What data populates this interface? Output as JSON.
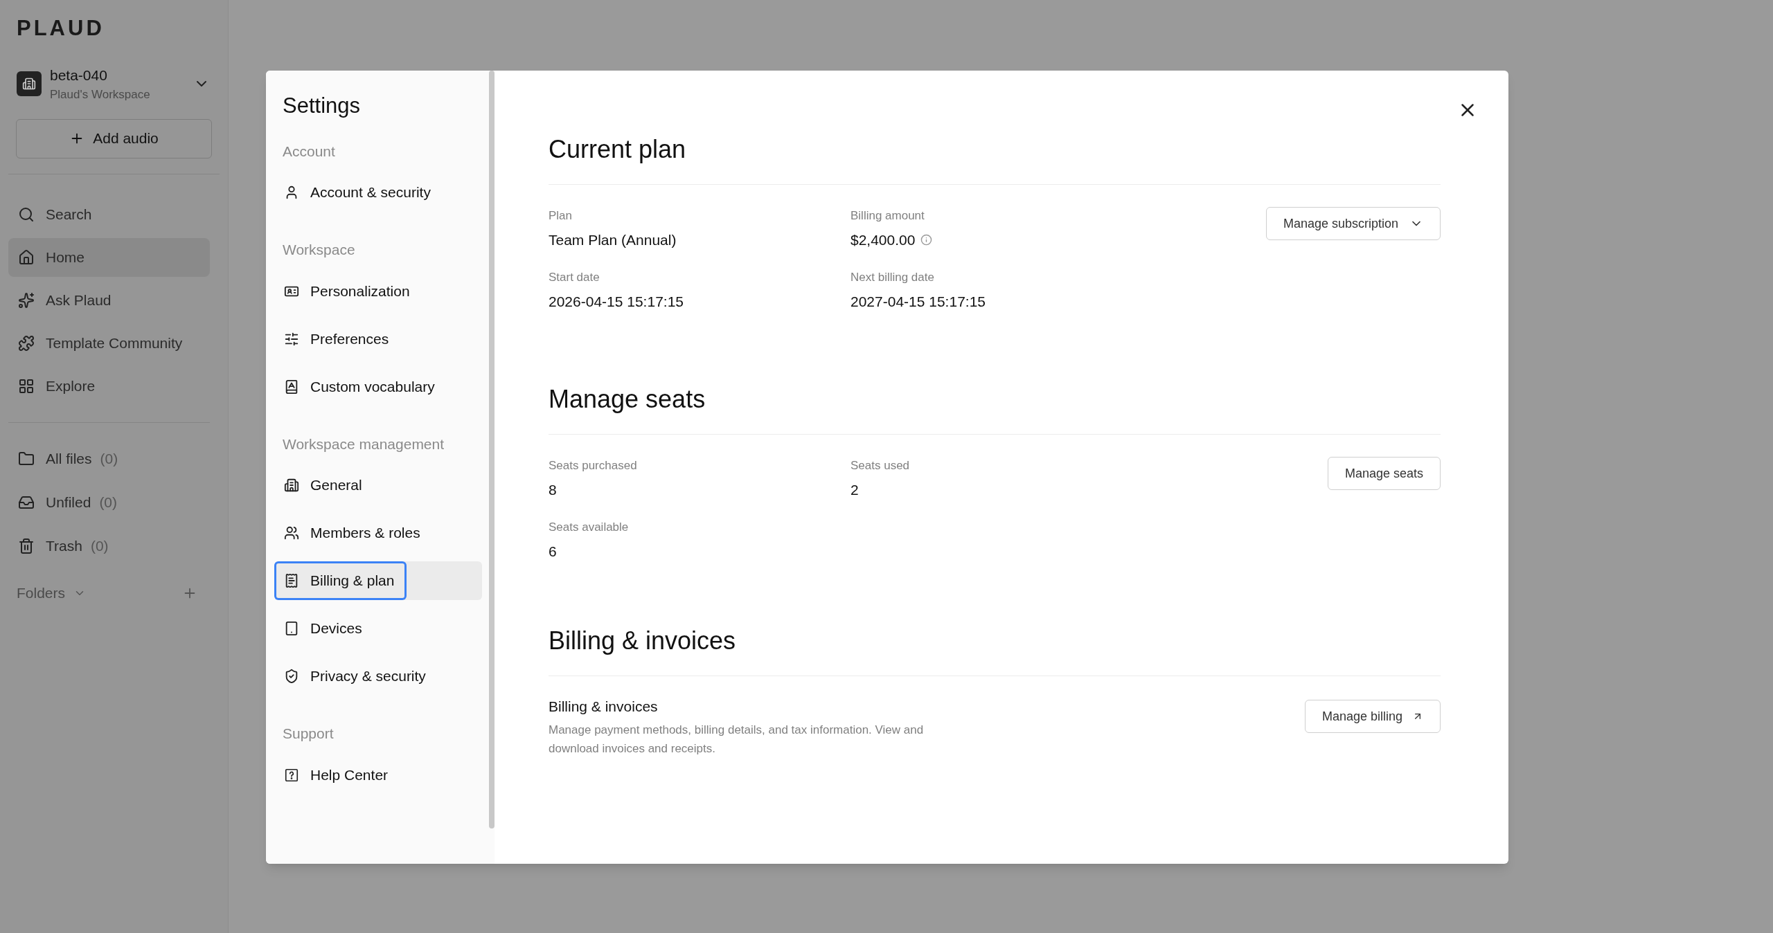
{
  "sidebar": {
    "logo": "PLAUD",
    "workspace": {
      "name": "beta-040",
      "subtitle": "Plaud's Workspace"
    },
    "add_button": "Add audio",
    "nav": [
      {
        "label": "Search",
        "selected": false
      },
      {
        "label": "Home",
        "selected": true
      },
      {
        "label": "Ask Plaud",
        "selected": false
      },
      {
        "label": "Template Community",
        "selected": false
      },
      {
        "label": "Explore",
        "selected": false
      }
    ],
    "files": [
      {
        "label": "All files",
        "count": "(0)"
      },
      {
        "label": "Unfiled",
        "count": "(0)"
      },
      {
        "label": "Trash",
        "count": "(0)"
      }
    ],
    "folders": "Folders"
  },
  "settings": {
    "title": "Settings",
    "sections": [
      {
        "heading": "Account",
        "items": [
          {
            "label": "Account & security",
            "selected": false,
            "focused": false
          }
        ]
      },
      {
        "heading": "Workspace",
        "items": [
          {
            "label": "Personalization",
            "selected": false,
            "focused": false
          },
          {
            "label": "Preferences",
            "selected": false,
            "focused": false
          },
          {
            "label": "Custom vocabulary",
            "selected": false,
            "focused": false
          }
        ]
      },
      {
        "heading": "Workspace management",
        "items": [
          {
            "label": "General",
            "selected": false,
            "focused": false
          },
          {
            "label": "Members & roles",
            "selected": false,
            "focused": false
          },
          {
            "label": "Billing & plan",
            "selected": true,
            "focused": true
          },
          {
            "label": "Devices",
            "selected": false,
            "focused": false
          },
          {
            "label": "Privacy & security",
            "selected": false,
            "focused": false
          }
        ]
      },
      {
        "heading": "Support",
        "items": [
          {
            "label": "Help Center",
            "selected": false,
            "focused": false
          }
        ]
      }
    ],
    "current_plan": {
      "heading": "Current plan",
      "fields": [
        {
          "label": "Plan",
          "value": "Team Plan (Annual)",
          "info": false
        },
        {
          "label": "Billing amount",
          "value": "$2,400.00",
          "info": true
        },
        {
          "label": "Start date",
          "value": "2026-04-15 15:17:15",
          "info": false
        },
        {
          "label": "Next billing date",
          "value": "2027-04-15 15:17:15",
          "info": false
        }
      ],
      "button": "Manage subscription"
    },
    "seats": {
      "heading": "Manage seats",
      "fields": [
        {
          "label": "Seats purchased",
          "value": "8",
          "info": false
        },
        {
          "label": "Seats used",
          "value": "2",
          "info": false
        },
        {
          "label": "Seats available",
          "value": "6",
          "info": false
        }
      ],
      "button": "Manage seats"
    },
    "billing": {
      "heading": "Billing & invoices",
      "subtitle": "Billing & invoices",
      "description": "Manage payment methods, billing details, and tax information. View and download invoices and receipts.",
      "button": "Manage billing"
    }
  }
}
